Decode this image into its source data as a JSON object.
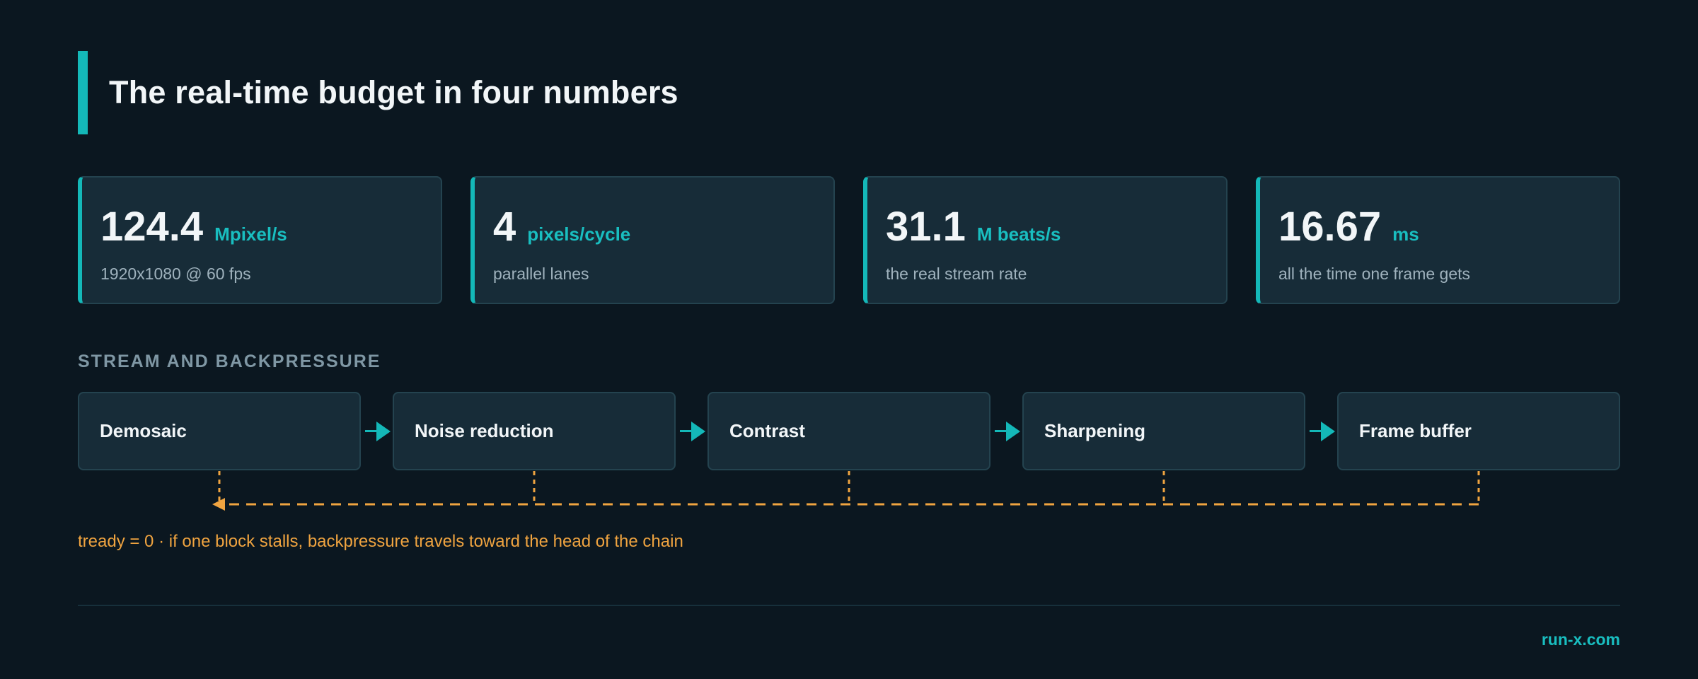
{
  "header": {
    "title": "The real-time budget in four numbers"
  },
  "metrics": [
    {
      "value": "124.4",
      "unit": "Mpixel/s",
      "description": "1920x1080 @ 60 fps"
    },
    {
      "value": "4",
      "unit": "pixels/cycle",
      "description": "parallel lanes"
    },
    {
      "value": "31.1",
      "unit": "M beats/s",
      "description": "the real stream rate"
    },
    {
      "value": "16.67",
      "unit": "ms",
      "description": "all the time one frame gets"
    }
  ],
  "pipeline": {
    "section_label": "STREAM AND BACKPRESSURE",
    "stages": [
      "Demosaic",
      "Noise reduction",
      "Contrast",
      "Sharpening",
      "Frame buffer"
    ],
    "note": "tready = 0 · if one block stalls, backpressure travels toward the head of the chain"
  },
  "footer": {
    "brand": "run-x.com"
  },
  "colors": {
    "background": "#0b1720",
    "accent": "#14b8b8",
    "card": "#172c38",
    "backpressure": "#f0a440"
  }
}
